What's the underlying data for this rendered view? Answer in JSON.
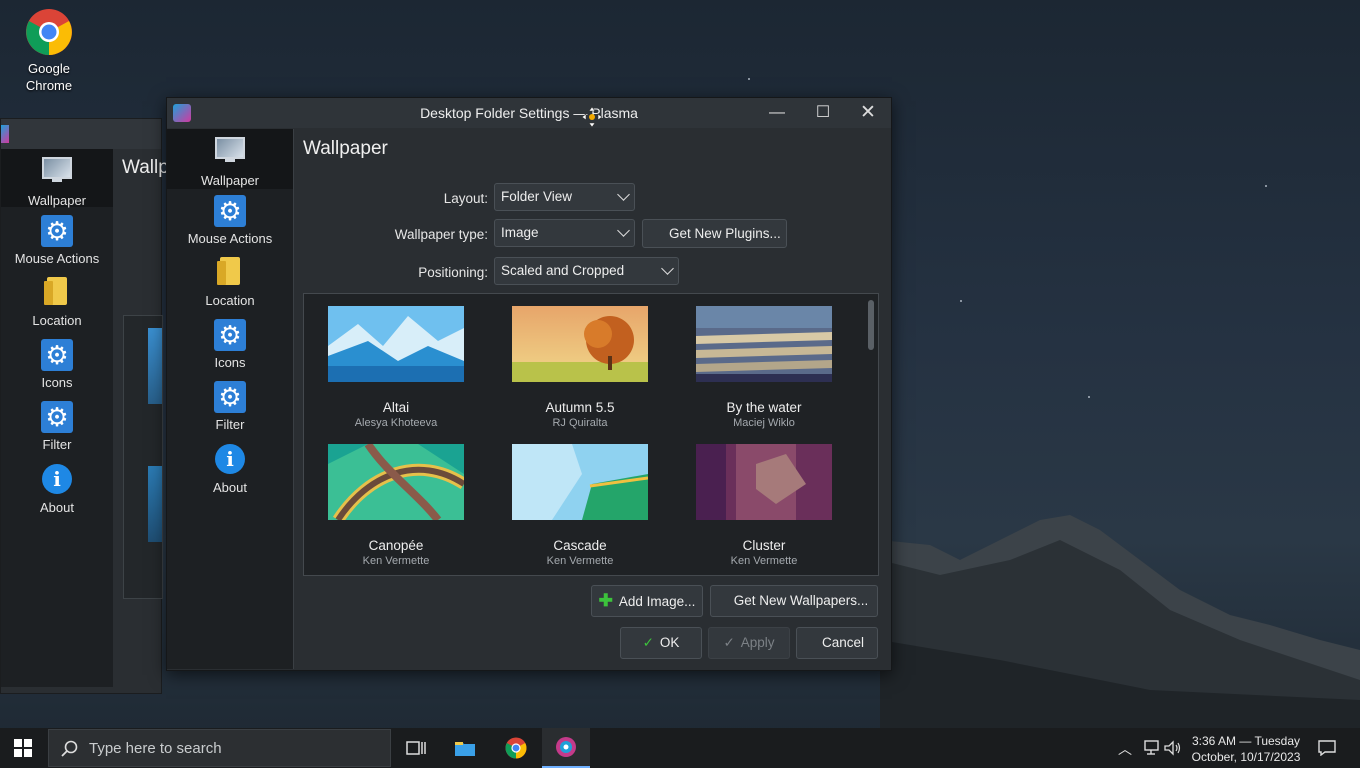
{
  "desktop": {
    "icons": [
      {
        "label": "Google Chrome"
      }
    ]
  },
  "background_window": {
    "title_partial": "Wallp",
    "nav": [
      "Wallpaper",
      "Mouse Actions",
      "Location",
      "Icons",
      "Filter",
      "About"
    ]
  },
  "dialog": {
    "title": "Desktop Folder Settings — Plasma",
    "nav": [
      {
        "label": "Wallpaper",
        "icon": "monitor-icon"
      },
      {
        "label": "Mouse Actions",
        "icon": "gear-icon"
      },
      {
        "label": "Location",
        "icon": "folder-icon"
      },
      {
        "label": "Icons",
        "icon": "gear-icon"
      },
      {
        "label": "Filter",
        "icon": "gear-icon"
      },
      {
        "label": "About",
        "icon": "info-icon"
      }
    ],
    "heading": "Wallpaper",
    "form": {
      "layout_label": "Layout:",
      "layout_value": "Folder View",
      "type_label": "Wallpaper type:",
      "type_value": "Image",
      "get_plugins": "Get New Plugins...",
      "positioning_label": "Positioning:",
      "positioning_value": "Scaled and Cropped"
    },
    "wallpapers": [
      {
        "name": "Altai",
        "author": "Alesya Khoteeva"
      },
      {
        "name": "Autumn 5.5",
        "author": "RJ Quiralta"
      },
      {
        "name": "By the water",
        "author": "Maciej Wiklo"
      },
      {
        "name": "Canopée",
        "author": "Ken Vermette"
      },
      {
        "name": "Cascade",
        "author": "Ken Vermette"
      },
      {
        "name": "Cluster",
        "author": "Ken Vermette"
      }
    ],
    "buttons": {
      "add_image": "Add Image...",
      "get_wallpapers": "Get New Wallpapers...",
      "ok": "OK",
      "apply": "Apply",
      "cancel": "Cancel"
    }
  },
  "taskbar": {
    "search_placeholder": "Type here to search",
    "clock_line1": "3:36 AM — Tuesday",
    "clock_line2": "October, 10/17/2023"
  }
}
